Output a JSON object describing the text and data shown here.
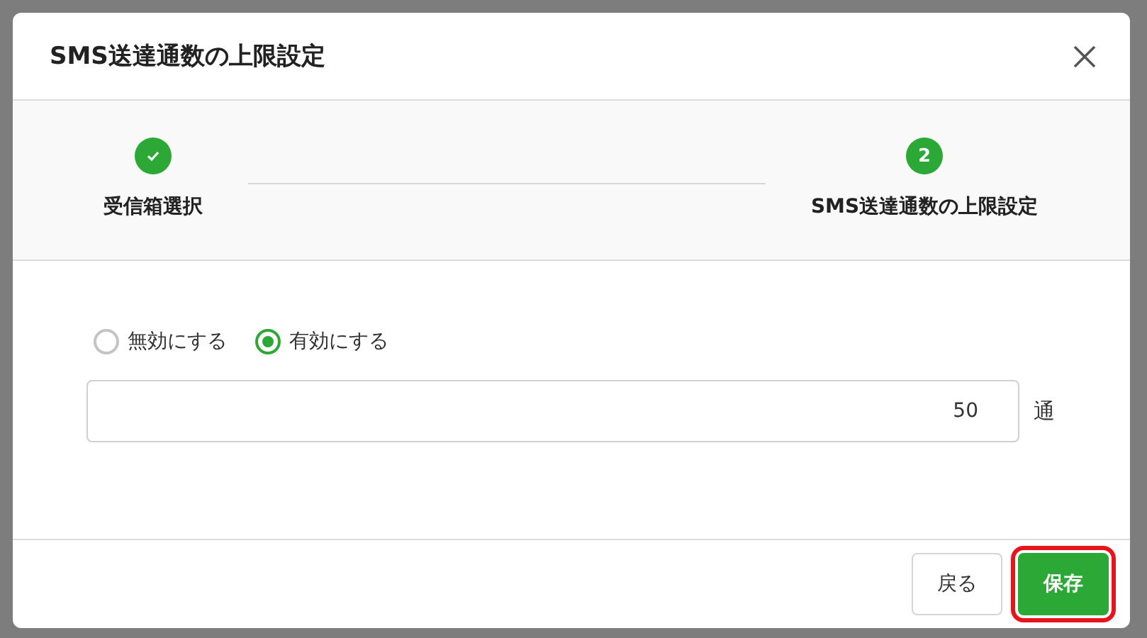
{
  "dialog": {
    "title": "SMS送達通数の上限設定"
  },
  "steps": [
    {
      "label": "受信箱選択",
      "completed": true
    },
    {
      "label": "SMS送達通数の上限設定",
      "completed": false,
      "number": "2"
    }
  ],
  "options": [
    {
      "label": "無効にする",
      "selected": false
    },
    {
      "label": "有効にする",
      "selected": true
    }
  ],
  "limit_field": {
    "value": "50",
    "unit": "通"
  },
  "buttons": [
    {
      "label": "戻る",
      "kind": "secondary",
      "focused": false
    },
    {
      "label": "保存",
      "kind": "primary",
      "focused": true
    }
  ]
}
